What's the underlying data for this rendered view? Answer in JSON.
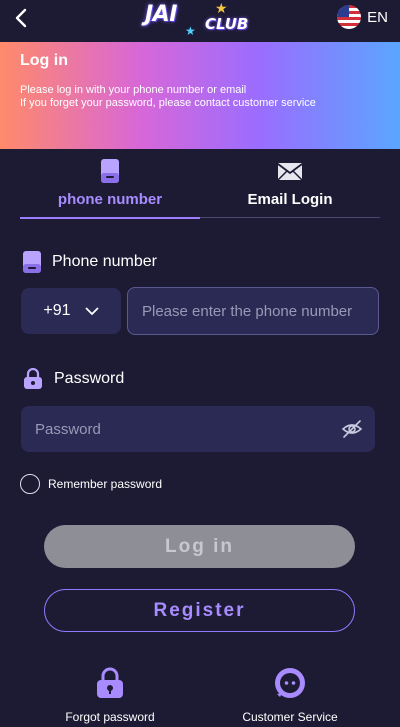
{
  "header": {
    "logo": {
      "word1": "JAI",
      "word2": "CLUB"
    },
    "language": "EN"
  },
  "banner": {
    "title": "Log in",
    "line1": "Please log in with your phone number or email",
    "line2": "If you forget your password, please contact customer service"
  },
  "tabs": [
    {
      "label": "phone number",
      "icon": "phone-icon",
      "active": true
    },
    {
      "label": "Email Login",
      "icon": "mail-icon",
      "active": false
    }
  ],
  "phone": {
    "label": "Phone number",
    "country_code": "+91",
    "placeholder": "Please enter the phone number"
  },
  "password": {
    "label": "Password",
    "placeholder": "Password"
  },
  "remember_label": "Remember password",
  "buttons": {
    "login": "Log in",
    "register": "Register"
  },
  "bottom": {
    "forgot": "Forgot password",
    "service": "Customer Service"
  },
  "colors": {
    "background": "#1d1b33",
    "accent": "#a88cff",
    "field": "#2a2a55"
  }
}
